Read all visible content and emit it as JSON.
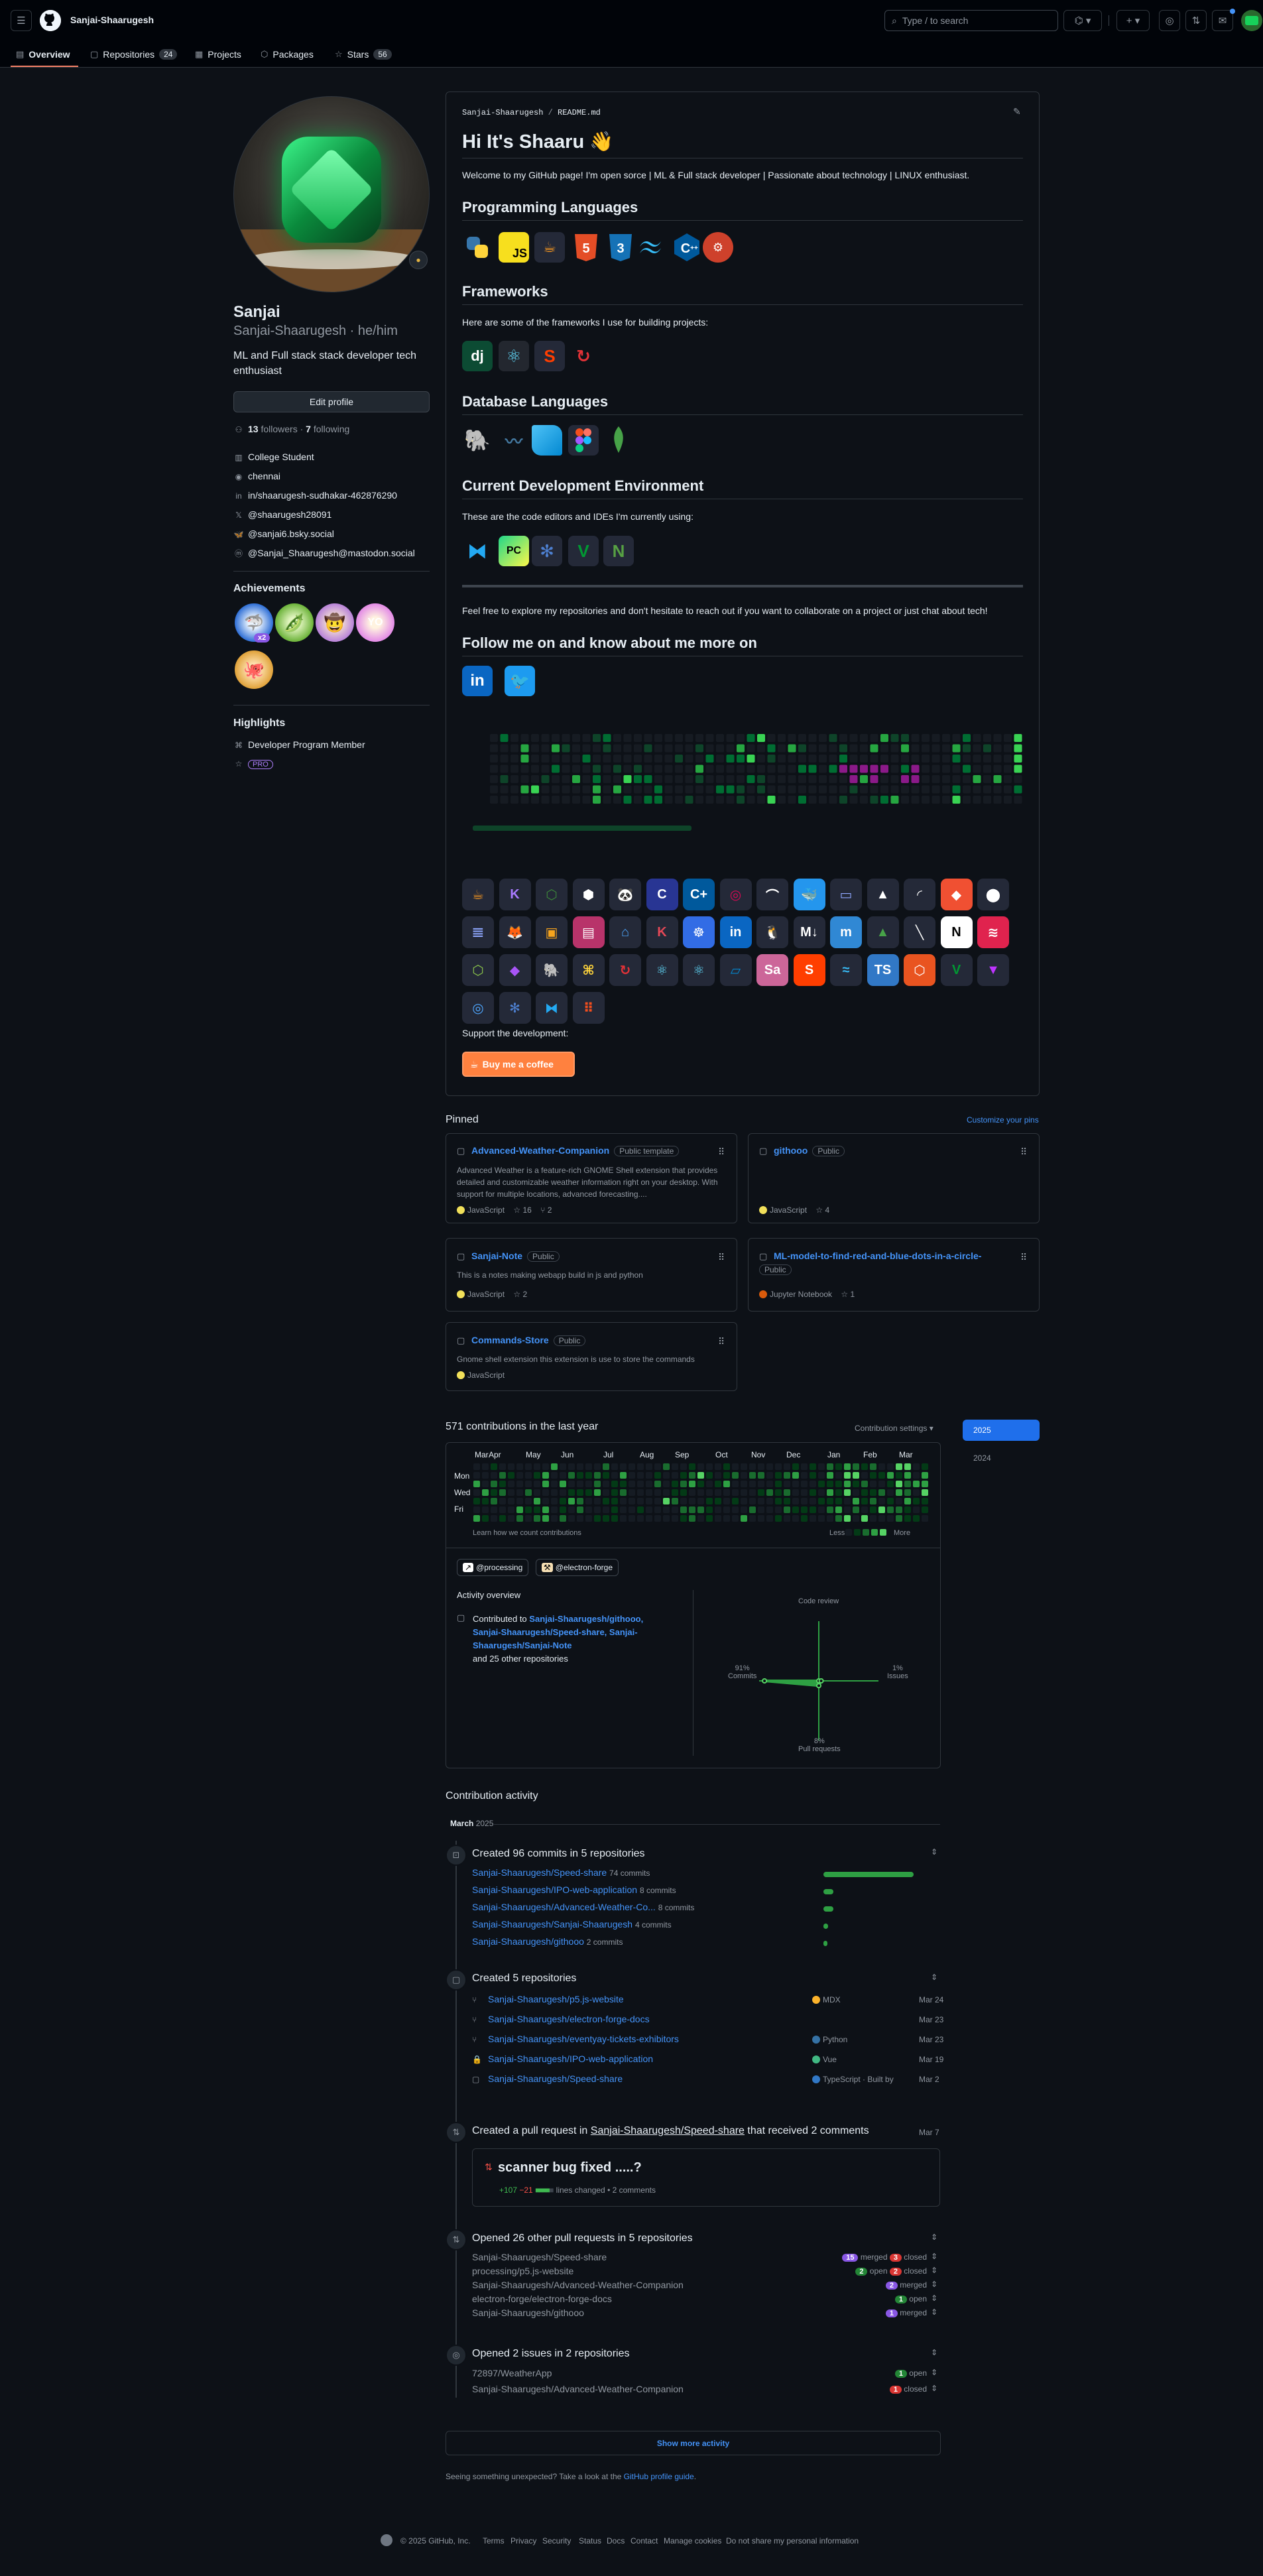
{
  "header": {
    "username": "Sanjai-Shaarugesh",
    "search_placeholder": "Type / to search"
  },
  "tabs": [
    {
      "label": "Overview",
      "icon": "book-icon"
    },
    {
      "label": "Repositories",
      "icon": "repo-icon",
      "count": "24"
    },
    {
      "label": "Projects",
      "icon": "table-icon"
    },
    {
      "label": "Packages",
      "icon": "package-icon"
    },
    {
      "label": "Stars",
      "icon": "star-icon",
      "count": "56"
    }
  ],
  "profile": {
    "name": "Sanjai",
    "login": "Sanjai-Shaarugesh",
    "pronouns": "he/him",
    "bio_line1": "ML and Full stack stack developer tech",
    "bio_line2": "enthusiast",
    "edit_label": "Edit profile",
    "followers": "13",
    "followers_label": "followers",
    "following": "7",
    "following_label": "following",
    "org": "College Student",
    "location": "chennai",
    "linkedin": "in/shaarugesh-sudhakar-462876290",
    "x": "@shaarugesh28091",
    "bluesky": "@sanjai6.bsky.social",
    "mastodon": "@Sanjai_Shaarugesh@mastodon.social",
    "achievements_title": "Achievements",
    "achievement_count": "x2",
    "highlights_title": "Highlights",
    "highlight1": "Developer Program Member",
    "highlight2": "PRO"
  },
  "readme": {
    "path_user": "Sanjai-Shaarugesh",
    "path_sep": "/",
    "path_file": "README.md",
    "title": "Hi It's Shaaru 👋",
    "welcome": "Welcome to my GitHub page! I'm open sorce | ML & Full stack developer | Passionate about technology | LINUX enthusiast.",
    "h_lang": "Programming Languages",
    "h_frameworks": "Frameworks",
    "frameworks_intro": "Here are some of the frameworks I use for building projects:",
    "h_db": "Database Languages",
    "h_env": "Current Development Environment",
    "env_intro": "These are the code editors and IDEs I'm currently using:",
    "explore": "Feel free to explore my repositories and don't hesitate to reach out if you want to collaborate on a project or just chat about tech!",
    "h_follow": "Follow me on and know about me more on",
    "support": "Support the development:",
    "coffee": "Buy me a coffee"
  },
  "pinned": {
    "title": "Pinned",
    "customize": "Customize your pins",
    "visibility_public": "Public",
    "visibility_template": "Public template",
    "items": [
      {
        "name": "Advanced-Weather-Companion",
        "visibility": "Public template",
        "desc1": "Advanced Weather is a feature-rich GNOME Shell extension that provides",
        "desc2": "detailed and customizable weather information right on your desktop. With",
        "desc3": "support for multiple locations, advanced forecasting....",
        "lang": "JavaScript",
        "lang_color": "#f1e05a",
        "stars": "16",
        "forks": "2"
      },
      {
        "name": "githooo",
        "visibility": "Public",
        "lang": "JavaScript",
        "lang_color": "#f1e05a",
        "stars": "4"
      },
      {
        "name": "Sanjai-Note",
        "visibility": "Public",
        "desc1": "This is a notes making webapp build in js and python",
        "lang": "JavaScript",
        "lang_color": "#f1e05a",
        "stars": "2"
      },
      {
        "name": "ML-model-to-find-red-and-blue-dots-in-a-circle-",
        "visibility": "Public",
        "lang": "Jupyter Notebook",
        "lang_color": "#DA5B0B",
        "stars": "1"
      },
      {
        "name": "Commands-Store",
        "visibility": "Public",
        "desc1": "Gnome shell extension this extension is use to store the commands",
        "lang": "JavaScript",
        "lang_color": "#f1e05a"
      }
    ]
  },
  "contributions": {
    "summary": "571 contributions in the last year",
    "settings": "Contribution settings",
    "years": [
      "2025",
      "2024"
    ],
    "months": [
      "Mar",
      "Apr",
      "May",
      "Jun",
      "Jul",
      "Aug",
      "Sep",
      "Oct",
      "Nov",
      "Dec",
      "Jan",
      "Feb",
      "Mar"
    ],
    "days": [
      "Mon",
      "Wed",
      "Fri"
    ],
    "learn": "Learn how we count contributions",
    "less": "Less",
    "more": "More",
    "orgs": [
      "@processing",
      "@electron-forge"
    ],
    "overview_title": "Activity overview",
    "contributed_prefix": "Contributed to",
    "contributed_repos": "Sanjai-Shaarugesh/githooo,",
    "contributed_repos2": "Sanjai-Shaarugesh/Speed-share,",
    "contributed_repos3": "Sanjai-Shaarugesh/Sanjai-Note",
    "contributed_more": "and 25 other repositories",
    "radar": {
      "code_review": "Code review",
      "commits_pct": "91%",
      "commits": "Commits",
      "issues_pct": "1%",
      "issues": "Issues",
      "pr_pct": "8%",
      "pr": "Pull requests",
      "values": {
        "commits": 91,
        "issues": 1,
        "pull_requests": 8,
        "code_review": 0
      }
    }
  },
  "activity": {
    "title": "Contribution activity",
    "month": "March",
    "year": "2025",
    "commits_title": "Created 96 commits in 5 repositories",
    "commit_rows": [
      {
        "repo": "Sanjai-Shaarugesh/Speed-share",
        "count": "74 commits",
        "value": 74
      },
      {
        "repo": "Sanjai-Shaarugesh/IPO-web-application",
        "count": "8 commits",
        "value": 8
      },
      {
        "repo": "Sanjai-Shaarugesh/Advanced-Weather-Co...",
        "count": "8 commits",
        "value": 8
      },
      {
        "repo": "Sanjai-Shaarugesh/Sanjai-Shaarugesh",
        "count": "4 commits",
        "value": 4
      },
      {
        "repo": "Sanjai-Shaarugesh/githooo",
        "count": "2 commits",
        "value": 2
      }
    ],
    "repos_title": "Created 5 repositories",
    "repo_rows": [
      {
        "repo": "Sanjai-Shaarugesh/p5.js-website",
        "lang": "MDX",
        "color": "#fcb32c",
        "date": "Mar 24"
      },
      {
        "repo": "Sanjai-Shaarugesh/electron-forge-docs",
        "lang": "",
        "color": "",
        "date": "Mar 23"
      },
      {
        "repo": "Sanjai-Shaarugesh/eventyay-tickets-exhibitors",
        "lang": "Python",
        "color": "#3572A5",
        "date": "Mar 23"
      },
      {
        "repo": "Sanjai-Shaarugesh/IPO-web-application",
        "lang": "Vue",
        "color": "#41b883",
        "date": "Mar 19"
      },
      {
        "repo": "Sanjai-Shaarugesh/Speed-share",
        "lang": "TypeScript",
        "color": "#3178c6",
        "date": "Mar 2",
        "built": "Built by"
      }
    ],
    "pr_title_prefix": "Created a pull request in",
    "pr_repo": "Sanjai-Shaarugesh/Speed-share",
    "pr_title_suffix": "that received 2 comments",
    "pr_date": "Mar 7",
    "pr_name": "scanner bug fixed .....?",
    "pr_add": "+107",
    "pr_del": "−21",
    "pr_lines": "lines changed",
    "pr_comments": "• 2 comments",
    "other_pr_title": "Opened 26 other pull requests in 5 repositories",
    "other_prs": [
      {
        "repo": "Sanjai-Shaarugesh/Speed-share",
        "a": "15",
        "a_label": "merged",
        "a_color": "#8957e5",
        "b": "3",
        "b_label": "closed",
        "b_color": "#da3633"
      },
      {
        "repo": "processing/p5.js-website",
        "a": "2",
        "a_label": "open",
        "a_color": "#238636",
        "b": "2",
        "b_label": "closed",
        "b_color": "#da3633"
      },
      {
        "repo": "Sanjai-Shaarugesh/Advanced-Weather-Companion",
        "a": "2",
        "a_label": "merged",
        "a_color": "#8957e5"
      },
      {
        "repo": "electron-forge/electron-forge-docs",
        "a": "1",
        "a_label": "open",
        "a_color": "#238636"
      },
      {
        "repo": "Sanjai-Shaarugesh/githooo",
        "a": "1",
        "a_label": "merged",
        "a_color": "#8957e5"
      }
    ],
    "issues_title": "Opened 2 issues in 2 repositories",
    "issues": [
      {
        "repo": "72897/WeatherApp",
        "a": "1",
        "a_label": "open",
        "a_color": "#238636"
      },
      {
        "repo": "Sanjai-Shaarugesh/Advanced-Weather-Companion",
        "a": "1",
        "a_label": "closed",
        "a_color": "#da3633"
      }
    ],
    "show_more": "Show more activity",
    "unexpected_prefix": "Seeing something unexpected? Take a look at the",
    "unexpected_link": "GitHub profile guide",
    "unexpected_suffix": "."
  },
  "footer": {
    "copyright": "© 2025 GitHub, Inc.",
    "links": [
      "Terms",
      "Privacy",
      "Security",
      "Status",
      "Docs",
      "Contact",
      "Manage cookies",
      "Do not share my personal information"
    ]
  },
  "colors": {
    "bg": "#0d1117",
    "accent_blue": "#4493f8",
    "tab_underline": "#f78166",
    "green": "#39d353",
    "year_active": "#1f6feb"
  }
}
